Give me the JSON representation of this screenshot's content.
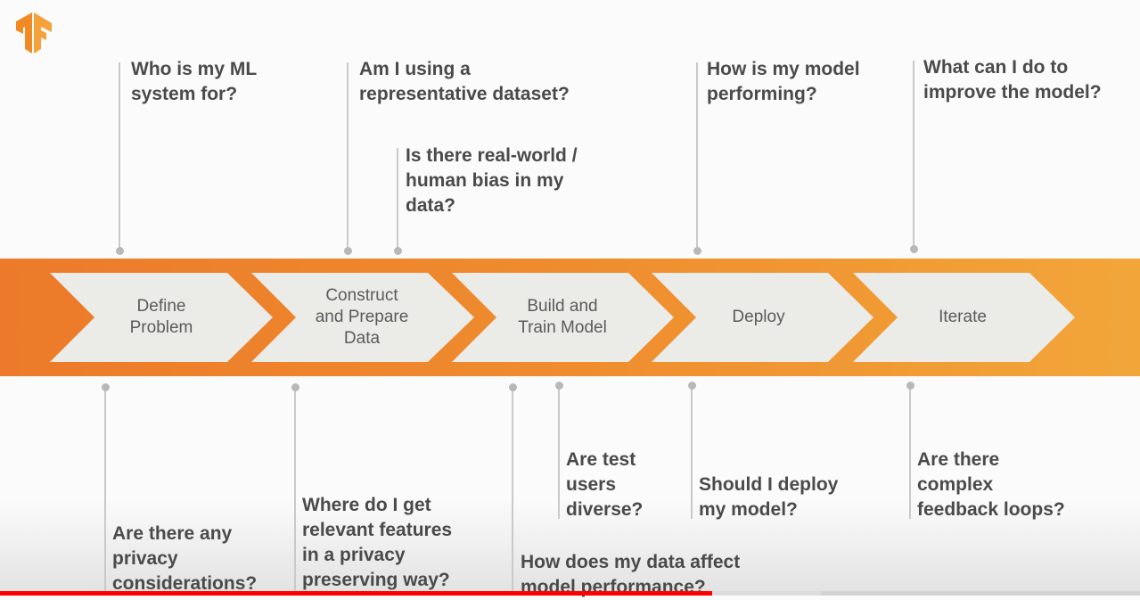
{
  "brand": {
    "logo": "tensorflow-logo-icon",
    "accent": "#f08a2c"
  },
  "steps": [
    {
      "label_lines": [
        "Define",
        "Problem"
      ]
    },
    {
      "label_lines": [
        "Construct",
        "and Prepare",
        "Data"
      ]
    },
    {
      "label_lines": [
        "Build and",
        "Train Model"
      ]
    },
    {
      "label_lines": [
        "Deploy"
      ]
    },
    {
      "label_lines": [
        "Iterate"
      ]
    }
  ],
  "questions_top": [
    {
      "lines": [
        "Who is my ML",
        "system for?"
      ]
    },
    {
      "lines": [
        "Am I using a",
        "representative dataset?"
      ]
    },
    {
      "lines": [
        "Is there real-world /",
        "human bias in my",
        "data?"
      ]
    },
    {
      "lines": [
        "How is my model",
        "performing?"
      ]
    },
    {
      "lines": [
        "What can I do to",
        "improve the model?"
      ]
    }
  ],
  "questions_bottom": [
    {
      "lines": [
        "Are there any",
        "privacy",
        "considerations?"
      ]
    },
    {
      "lines": [
        "Where do I get",
        "relevant features",
        "in a privacy",
        "preserving way?"
      ]
    },
    {
      "lines": [
        "How does my data affect",
        "model performance?"
      ]
    },
    {
      "lines": [
        "Are test",
        "users",
        "diverse?"
      ]
    },
    {
      "lines": [
        "Should I deploy",
        "my model?"
      ]
    },
    {
      "lines": [
        "Are there",
        "complex",
        "feedback loops?"
      ]
    }
  ],
  "video_progress": {
    "played_fraction": 0.625,
    "buffered_fraction": 0.72,
    "color": "#ff0000"
  }
}
